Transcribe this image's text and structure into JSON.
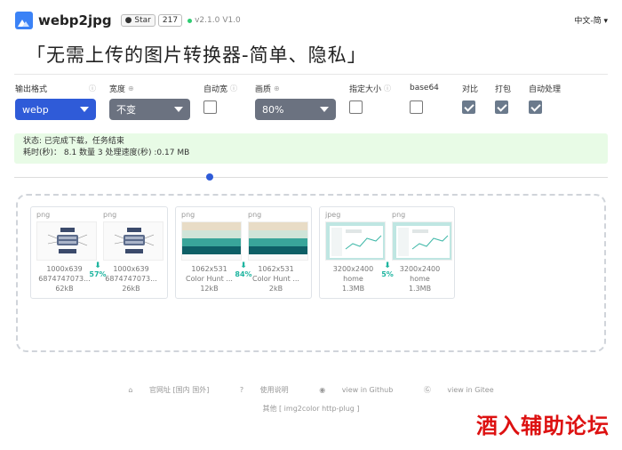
{
  "header": {
    "brand": "webp2jpg",
    "star_label": "Star",
    "star_count": "217",
    "version": "v2.1.0",
    "version_short": "V1.0",
    "language": "中文-简 ▾"
  },
  "title": "「无需上传的图片转换器-简单、隐私」",
  "options": {
    "format": {
      "label": "输出格式",
      "value": "webp"
    },
    "width": {
      "label": "宽度",
      "value": "不变"
    },
    "auto_width": {
      "label": "自动宽",
      "checked": false
    },
    "quality": {
      "label": "画质",
      "value": "80%"
    },
    "specify_size": {
      "label": "指定大小",
      "checked": false
    },
    "base64": {
      "label": "base64",
      "checked": false
    },
    "compare": {
      "label": "对比",
      "checked": true
    },
    "pack": {
      "label": "打包",
      "checked": true
    },
    "auto_process": {
      "label": "自动处理",
      "checked": true
    }
  },
  "status": {
    "line1": "状态: 已完成下载，任务结束",
    "line2": "耗时(秒)： 8.1 数量 3 处理速度(秒) :0.17 MB"
  },
  "progress": {
    "fraction": 0.33
  },
  "results": [
    {
      "saving": "57%",
      "items": [
        {
          "type": "png",
          "dims": "1000x639",
          "name": "6874747073...",
          "size": "62kB"
        },
        {
          "type": "png",
          "dims": "1000x639",
          "name": "6874747073...",
          "size": "26kB"
        }
      ]
    },
    {
      "saving": "84%",
      "items": [
        {
          "type": "png",
          "dims": "1062x531",
          "name": "Color Hunt ...",
          "size": "12kB"
        },
        {
          "type": "png",
          "dims": "1062x531",
          "name": "Color Hunt ...",
          "size": "2kB"
        }
      ]
    },
    {
      "saving": "5%",
      "items": [
        {
          "type": "jpeg",
          "dims": "3200x2400",
          "name": "home",
          "size": "1.3MB"
        },
        {
          "type": "png",
          "dims": "3200x2400",
          "name": "home",
          "size": "1.3MB"
        }
      ]
    }
  ],
  "footer": {
    "site": "官网址 [国内 国外]",
    "help": "使用说明",
    "github": "view in Github",
    "gitee": "view in Gitee",
    "others": "其他 [ img2color  http-plug ]"
  },
  "watermark": "酒入辅助论坛",
  "colors": {
    "accent": "#2f5bd8",
    "saving": "#1fb5a0",
    "status_bg": "#e8fbe6"
  }
}
